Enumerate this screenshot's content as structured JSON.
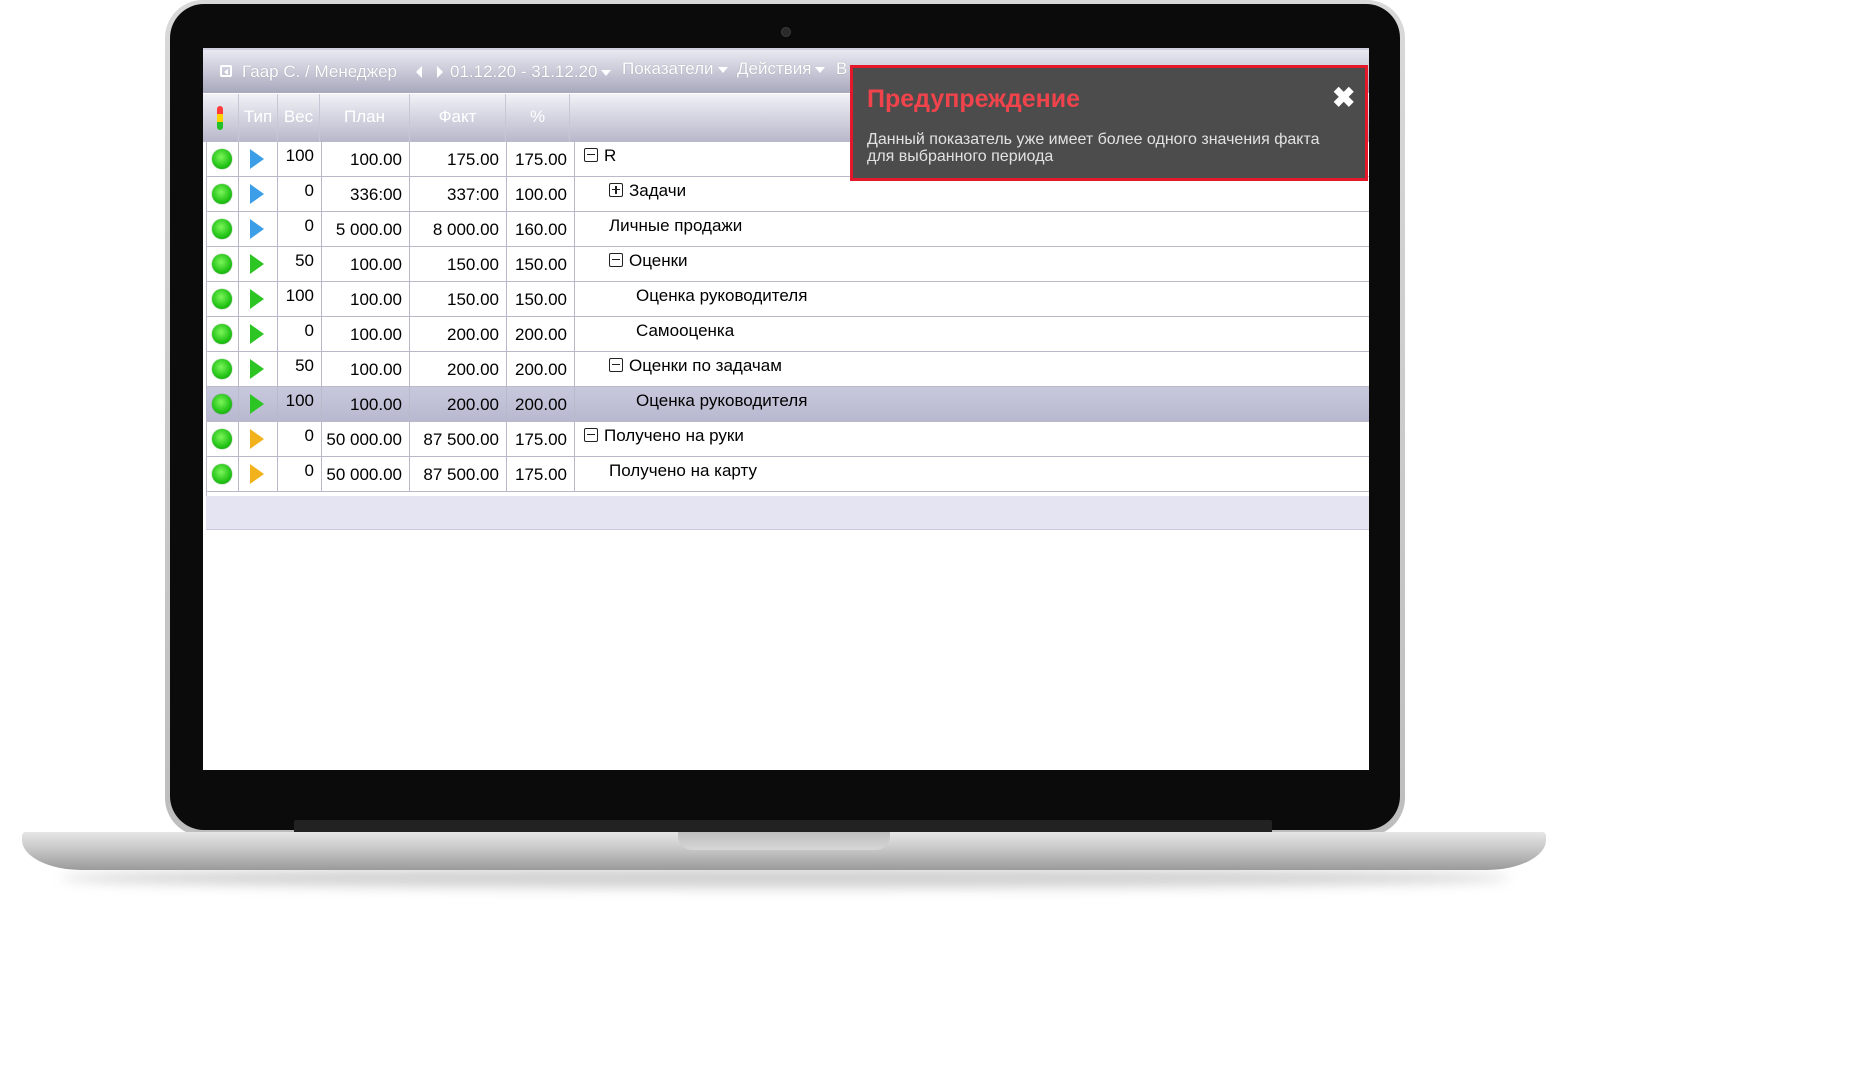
{
  "toolbar": {
    "user": "Гаар С. / Менеджер",
    "period": "01.12.20 - 31.12.20",
    "menu_indicators": "Показатели",
    "menu_actions": "Действия",
    "menu_more": "В"
  },
  "columns": {
    "type": "Тип",
    "weight": "Вес",
    "plan": "План",
    "fact": "Факт",
    "percent": "%"
  },
  "rows": [
    {
      "status": "green",
      "type_color": "#3c9ee6",
      "weight": "100",
      "plan": "100.00",
      "fact": "175.00",
      "percent": "175.00",
      "name": "R",
      "level": 0,
      "toggle": "minus"
    },
    {
      "status": "green",
      "type_color": "#3c9ee6",
      "weight": "0",
      "plan": "336:00",
      "fact": "337:00",
      "percent": "100.00",
      "name": "Задачи",
      "level": 1,
      "toggle": "plus"
    },
    {
      "status": "green",
      "type_color": "#3c9ee6",
      "weight": "0",
      "plan": "5 000.00",
      "fact": "8 000.00",
      "percent": "160.00",
      "name": "Личные продажи",
      "level": 1,
      "toggle": "none"
    },
    {
      "status": "green",
      "type_color": "#2cc524",
      "weight": "50",
      "plan": "100.00",
      "fact": "150.00",
      "percent": "150.00",
      "name": "Оценки",
      "level": 1,
      "toggle": "minus"
    },
    {
      "status": "green",
      "type_color": "#2cc524",
      "weight": "100",
      "plan": "100.00",
      "fact": "150.00",
      "percent": "150.00",
      "name": "Оценка руководителя",
      "level": 2,
      "toggle": "none"
    },
    {
      "status": "green",
      "type_color": "#2cc524",
      "weight": "0",
      "plan": "100.00",
      "fact": "200.00",
      "percent": "200.00",
      "name": "Самооценка",
      "level": 2,
      "toggle": "none"
    },
    {
      "status": "green",
      "type_color": "#2cc524",
      "weight": "50",
      "plan": "100.00",
      "fact": "200.00",
      "percent": "200.00",
      "name": "Оценки по задачам",
      "level": 1,
      "toggle": "minus"
    },
    {
      "status": "green",
      "type_color": "#2cc524",
      "weight": "100",
      "plan": "100.00",
      "fact": "200.00",
      "percent": "200.00",
      "name": "Оценка руководителя",
      "level": 2,
      "toggle": "none",
      "selected": true
    },
    {
      "status": "green",
      "type_color": "#f2b21c",
      "weight": "0",
      "plan": "50 000.00",
      "fact": "87 500.00",
      "percent": "175.00",
      "name": "Получено на руки",
      "level": 0,
      "toggle": "minus"
    },
    {
      "status": "green",
      "type_color": "#f2b21c",
      "weight": "0",
      "plan": "50 000.00",
      "fact": "87 500.00",
      "percent": "175.00",
      "name": "Получено на карту",
      "level": 1,
      "toggle": "none"
    }
  ],
  "warning": {
    "title": "Предупреждение",
    "message": "Данный показатель уже имеет более одного значения факта для выбранного периода"
  },
  "colors": {
    "warning_border": "#e3182a",
    "warning_title": "#f0434b",
    "selected_row": "#bcbcd3"
  }
}
